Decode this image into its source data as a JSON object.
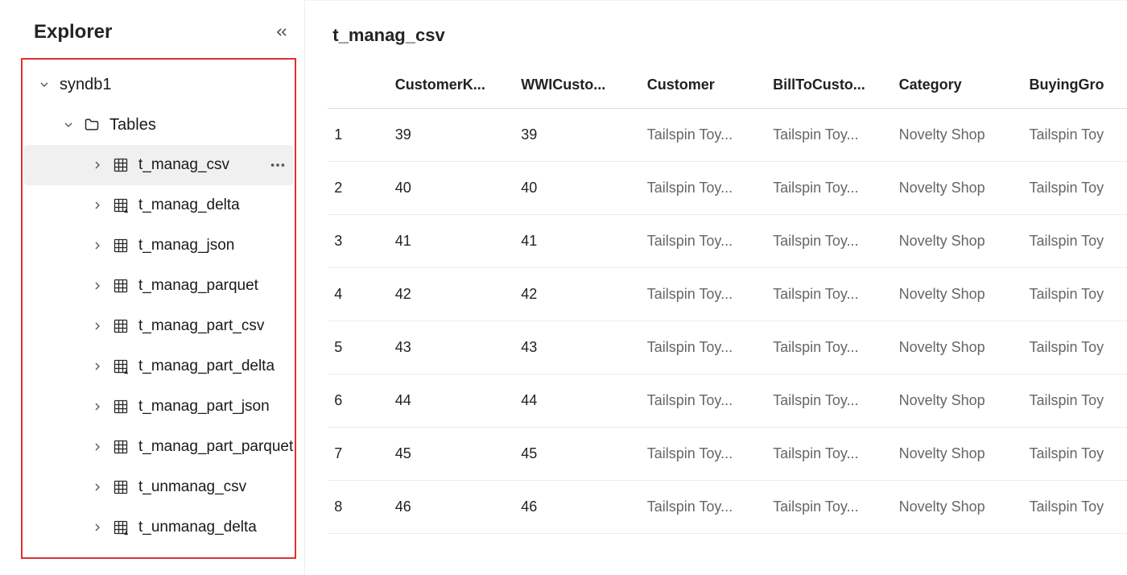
{
  "explorer": {
    "title": "Explorer",
    "database": "syndb1",
    "tables_group": "Tables",
    "tables": [
      {
        "name": "t_manag_csv",
        "delta": false
      },
      {
        "name": "t_manag_delta",
        "delta": true
      },
      {
        "name": "t_manag_json",
        "delta": false
      },
      {
        "name": "t_manag_parquet",
        "delta": false
      },
      {
        "name": "t_manag_part_csv",
        "delta": false
      },
      {
        "name": "t_manag_part_delta",
        "delta": true
      },
      {
        "name": "t_manag_part_json",
        "delta": false
      },
      {
        "name": "t_manag_part_parquet",
        "delta": false
      },
      {
        "name": "t_unmanag_csv",
        "delta": false
      },
      {
        "name": "t_unmanag_delta",
        "delta": true
      }
    ],
    "selected_table": "t_manag_csv"
  },
  "main": {
    "title": "t_manag_csv",
    "columns": [
      "CustomerK...",
      "WWICusto...",
      "Customer",
      "BillToCusto...",
      "Category",
      "BuyingGro"
    ],
    "rows": [
      {
        "idx": "1",
        "cells": [
          "39",
          "39",
          "Tailspin Toy...",
          "Tailspin Toy...",
          "Novelty Shop",
          "Tailspin Toy"
        ]
      },
      {
        "idx": "2",
        "cells": [
          "40",
          "40",
          "Tailspin Toy...",
          "Tailspin Toy...",
          "Novelty Shop",
          "Tailspin Toy"
        ]
      },
      {
        "idx": "3",
        "cells": [
          "41",
          "41",
          "Tailspin Toy...",
          "Tailspin Toy...",
          "Novelty Shop",
          "Tailspin Toy"
        ]
      },
      {
        "idx": "4",
        "cells": [
          "42",
          "42",
          "Tailspin Toy...",
          "Tailspin Toy...",
          "Novelty Shop",
          "Tailspin Toy"
        ]
      },
      {
        "idx": "5",
        "cells": [
          "43",
          "43",
          "Tailspin Toy...",
          "Tailspin Toy...",
          "Novelty Shop",
          "Tailspin Toy"
        ]
      },
      {
        "idx": "6",
        "cells": [
          "44",
          "44",
          "Tailspin Toy...",
          "Tailspin Toy...",
          "Novelty Shop",
          "Tailspin Toy"
        ]
      },
      {
        "idx": "7",
        "cells": [
          "45",
          "45",
          "Tailspin Toy...",
          "Tailspin Toy...",
          "Novelty Shop",
          "Tailspin Toy"
        ]
      },
      {
        "idx": "8",
        "cells": [
          "46",
          "46",
          "Tailspin Toy...",
          "Tailspin Toy...",
          "Novelty Shop",
          "Tailspin Toy"
        ]
      }
    ]
  }
}
